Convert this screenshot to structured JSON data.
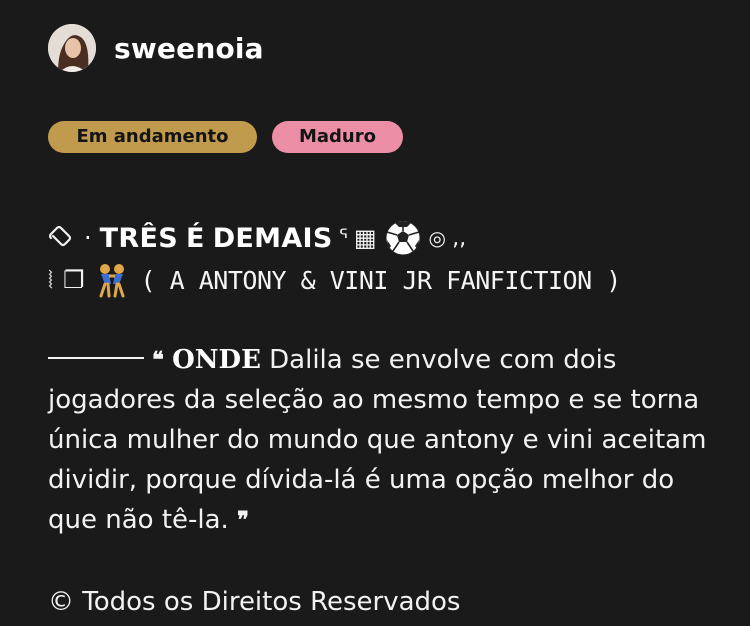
{
  "author": {
    "username": "sweenoia"
  },
  "tags": {
    "status": "Em andamento",
    "rating": "Maduro"
  },
  "title": {
    "prefix_glyph": "📎",
    "dot": "·",
    "word1": "TRÊS",
    "word2": "É",
    "word3": "DEMAIS",
    "hook_glyph": "ᕐ",
    "grid_glyph": "▦",
    "spiral_glyph": "◎",
    "quotes_glyph": "‚‚",
    "line2_lead_glyph": "⦚",
    "line2_square_glyph": "❐",
    "subtitle": "( A ANTONY & VINI JR FANFICTION )"
  },
  "description": {
    "open_quote": "❝",
    "lead_word": "ONDE",
    "text": " Dalila se envolve com dois jogadores da seleção ao mesmo tempo e se torna única mulher do mundo que antony e vini aceitam dividir, porque dívida-lá é uma opção melhor do que não tê-la. ",
    "close_quote": "❞"
  },
  "copyright": "© Todos os Direitos Reservados",
  "colors": {
    "background": "#1b1a1b",
    "status_tag": "#c09a4d",
    "rating_tag": "#ec8fa6",
    "text": "#f2f2f2"
  },
  "icons": {
    "avatar": "user-avatar-photo",
    "clip": "paperclip-icon",
    "soccer": "soccer-ball-icon",
    "wrestlers": "wrestlers-icon"
  }
}
